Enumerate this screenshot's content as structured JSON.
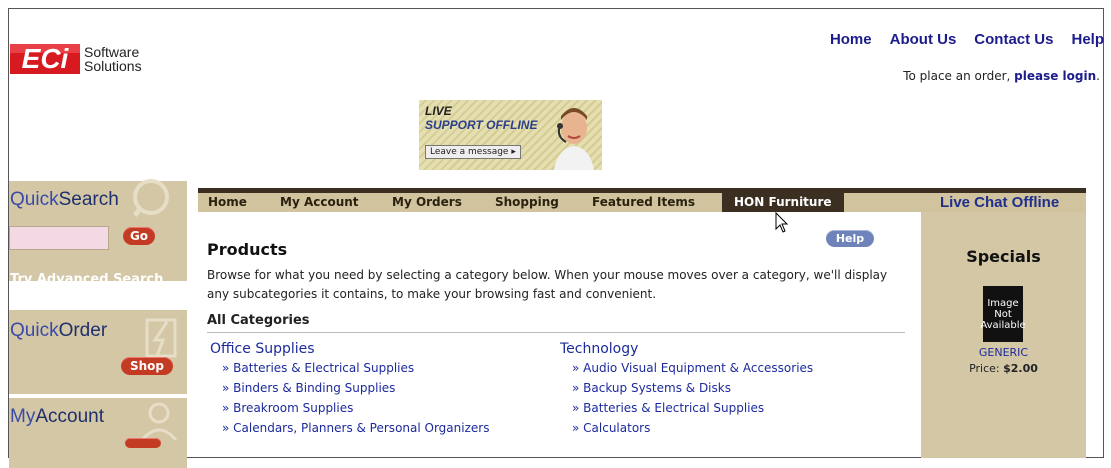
{
  "header": {
    "logo_mark": "ECi",
    "logo_line1": "Software",
    "logo_line2": "Solutions",
    "nav": [
      "Home",
      "About Us",
      "Contact Us",
      "Help"
    ],
    "login_prefix": "To place an order,",
    "login_link": "please login",
    "login_suffix": "."
  },
  "live_support": {
    "line1": "LIVE",
    "line2": "SUPPORT OFFLINE",
    "button": "Leave a message ▸"
  },
  "sidebar": {
    "quicksearch_a": "Quick",
    "quicksearch_b": "Search",
    "go_label": "Go",
    "advanced_label": "Try Advanced Search",
    "quickorder_a": "Quick",
    "quickorder_b": "Order",
    "shop_label": "Shop",
    "myaccount_a": "My",
    "myaccount_b": "Account"
  },
  "tabs": {
    "items": [
      "Home",
      "My Account",
      "My Orders",
      "Shopping",
      "Featured Items",
      "HON Furniture"
    ],
    "active": "HON Furniture",
    "live_chat": "Live Chat Offline"
  },
  "main": {
    "title": "Products",
    "help_label": "Help",
    "intro": "Browse for what you need by selecting a category below. When your mouse moves over a category, we'll display any subcategories it contains, to make your browsing fast and convenient.",
    "all_categories": "All Categories",
    "columns": [
      {
        "heading": "Office Supplies",
        "items": [
          "» Batteries & Electrical Supplies",
          "» Binders & Binding Supplies",
          "» Breakroom Supplies",
          "» Calendars, Planners & Personal Organizers"
        ]
      },
      {
        "heading": "Technology",
        "items": [
          "» Audio Visual Equipment & Accessories",
          "» Backup Systems & Disks",
          "» Batteries & Electrical Supplies",
          "» Calculators"
        ]
      }
    ]
  },
  "specials": {
    "title": "Specials",
    "image_text": "Image Not Available",
    "product_name": "GENERIC",
    "price_label": "Price:",
    "price_value": "$2.00"
  },
  "colors": {
    "brand_red": "#d71920",
    "link_blue": "#1c1c8c",
    "panel_tan": "#d3c7a6",
    "tab_dark": "#3a2f20"
  }
}
